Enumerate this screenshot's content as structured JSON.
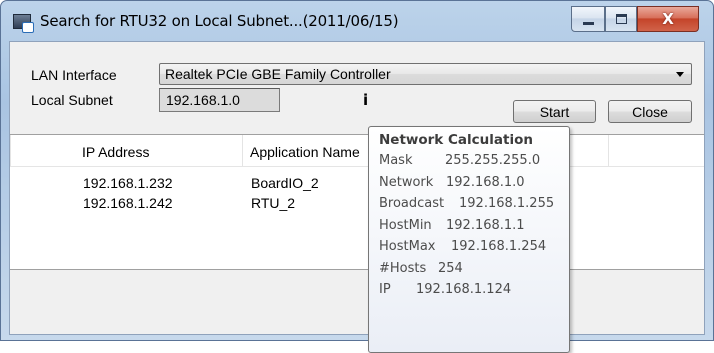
{
  "window": {
    "title": "Search for RTU32 on Local Subnet...(2011/06/15)",
    "caption_buttons": {
      "close_glyph": "X"
    }
  },
  "form": {
    "lan_label": "LAN Interface",
    "lan_value": "Realtek PCIe GBE Family Controller",
    "subnet_label": "Local Subnet",
    "subnet_value": "192.168.1.0",
    "info_glyph": "i",
    "start_label": "Start",
    "close_label": "Close"
  },
  "list": {
    "columns": [
      "IP Address",
      "Application Name"
    ],
    "rows": [
      {
        "ip": "192.168.1.232",
        "app": "BoardIO_2"
      },
      {
        "ip": "192.168.1.242",
        "app": "RTU_2"
      }
    ]
  },
  "tooltip": {
    "title": "Network Calculation",
    "rows": [
      {
        "key": "Mask",
        "value": "255.255.255.0"
      },
      {
        "key": "Network",
        "value": "192.168.1.0"
      },
      {
        "key": "Broadcast",
        "value": "192.168.1.255"
      },
      {
        "key": "HostMin",
        "value": "192.168.1.1"
      },
      {
        "key": "HostMax",
        "value": "192.168.1.254"
      },
      {
        "key": "#Hosts",
        "value": "254"
      },
      {
        "key": "IP",
        "value": "192.168.1.124"
      }
    ]
  },
  "colors": {
    "frame": "#a9c4e2",
    "close_button": "#c4442a",
    "client_bg": "#f0f0f0"
  },
  "icons": [
    "app-icon",
    "minimize-icon",
    "maximize-icon",
    "close-icon",
    "dropdown-arrow-icon",
    "info-icon"
  ]
}
